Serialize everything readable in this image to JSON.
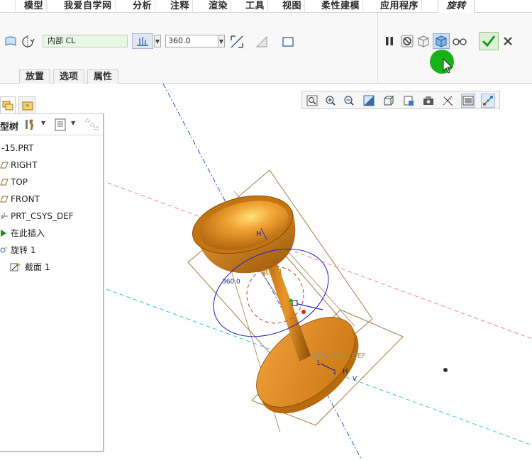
{
  "ribbon_tabs": [
    {
      "label": "模型"
    },
    {
      "label": "我爱自学网"
    },
    {
      "label": "分析"
    },
    {
      "label": "注释"
    },
    {
      "label": "渲染"
    },
    {
      "label": "工具"
    },
    {
      "label": "视图"
    },
    {
      "label": "柔性建模"
    },
    {
      "label": "应用程序"
    },
    {
      "label": "旋转",
      "active": true
    }
  ],
  "dashboard": {
    "side_value": "内部 CL",
    "angle_value": "360.0",
    "sub_tabs": [
      "放置",
      "选项",
      "属性"
    ],
    "accent_color": "#2aa52a"
  },
  "view_toolbar": {
    "buttons": [
      "zoom-to-fit-icon",
      "zoom-in-icon",
      "zoom-out-icon",
      "repaint-icon",
      "display-style-icon",
      "saved-views-icon",
      "view-manager-icon",
      "datum-display-icon",
      "annotation-display-icon",
      "spin-center-icon"
    ]
  },
  "tree": {
    "header_label": "型树",
    "items": [
      {
        "label": "-15.PRT",
        "icon": "part-icon",
        "indent": 0
      },
      {
        "label": "RIGHT",
        "icon": "datum-plane-icon",
        "indent": 0
      },
      {
        "label": "TOP",
        "icon": "datum-plane-icon",
        "indent": 0
      },
      {
        "label": "FRONT",
        "icon": "datum-plane-icon",
        "indent": 0
      },
      {
        "label": "PRT_CSYS_DEF",
        "icon": "csys-icon",
        "indent": 0
      },
      {
        "label": "在此插入",
        "icon": "insert-here-icon",
        "indent": 0
      },
      {
        "label": "旋转 1",
        "icon": "revolve-icon",
        "indent": 0
      },
      {
        "label": "截面 1",
        "icon": "sketch-icon",
        "indent": 1
      }
    ]
  },
  "viewport": {
    "labels": {
      "section": "截面 1",
      "angle_dim": "360.0",
      "csys": "PRT_CSYS_DEF",
      "h_top": "H",
      "h_bottom": "H",
      "v_bottom": "V",
      "dim_1": "1",
      "dim_2": "1"
    },
    "model_color": "#e08a14"
  }
}
